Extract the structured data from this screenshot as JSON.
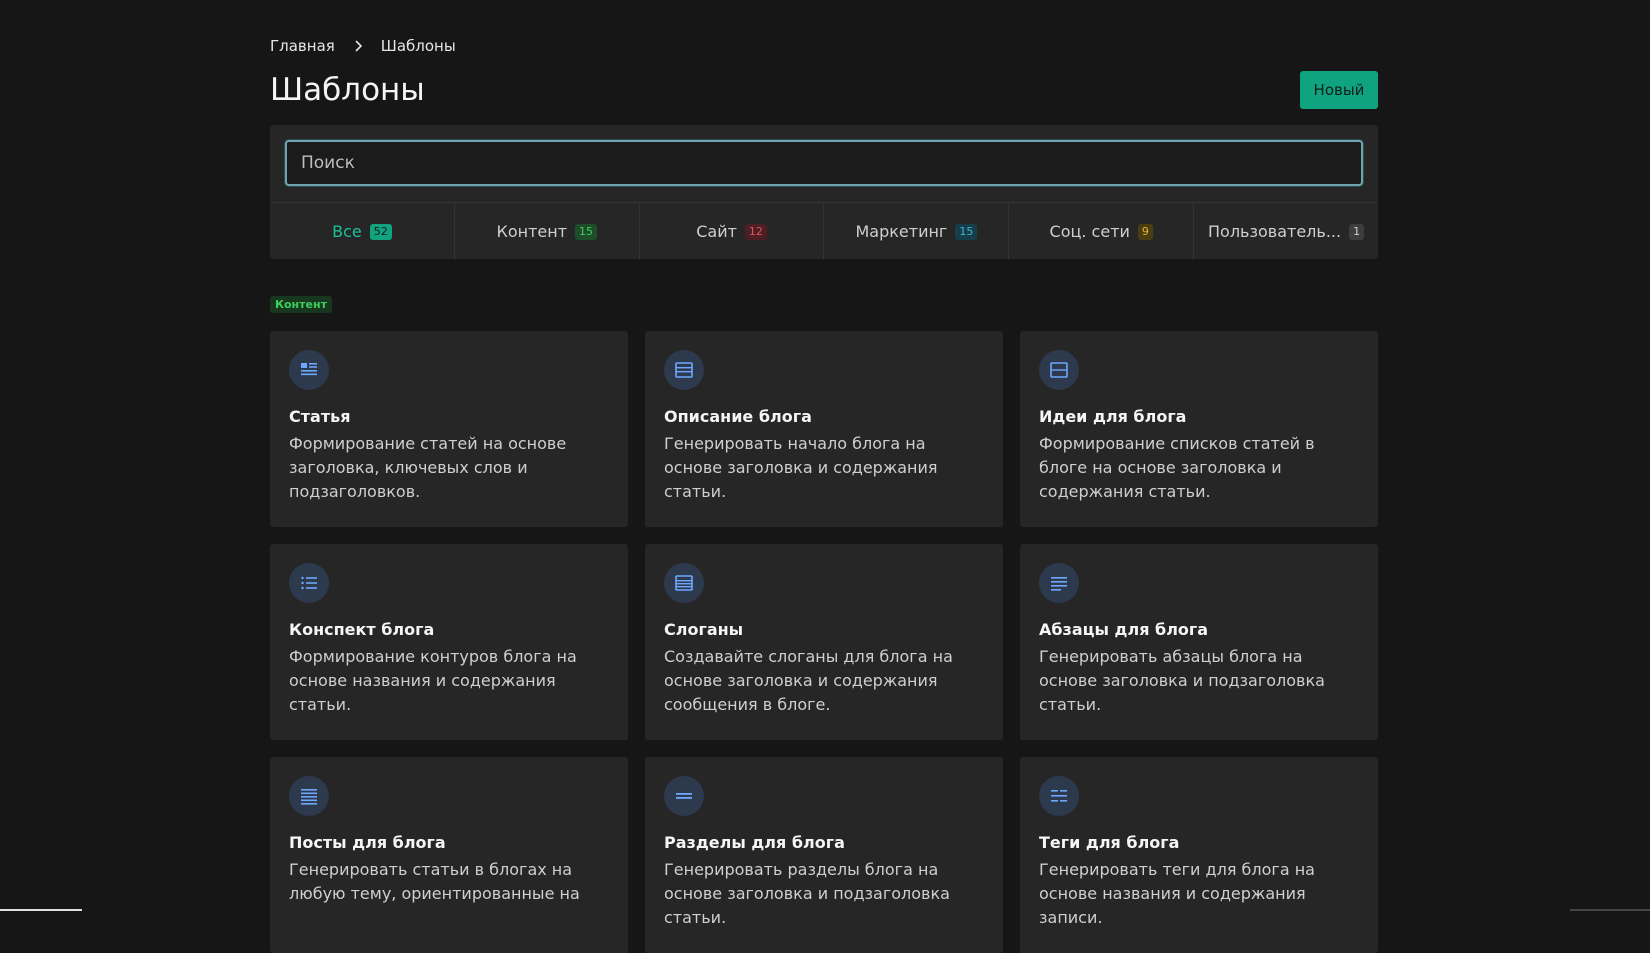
{
  "breadcrumb": {
    "home": "Главная",
    "current": "Шаблоны"
  },
  "header": {
    "title": "Шаблоны",
    "new_button": "Новый"
  },
  "search": {
    "placeholder": "Поиск",
    "value": ""
  },
  "tabs": [
    {
      "label": "Все",
      "count": "52",
      "color": "#10a37f",
      "text_color": "#0f1f1a",
      "active": true
    },
    {
      "label": "Контент",
      "count": "15",
      "color": "#1f4d2a",
      "text_color": "#3ecf5e",
      "active": false
    },
    {
      "label": "Сайт",
      "count": "12",
      "color": "#4d1f24",
      "text_color": "#e0535f",
      "active": false
    },
    {
      "label": "Маркетинг",
      "count": "15",
      "color": "#173c4a",
      "text_color": "#3eb6d6",
      "active": false
    },
    {
      "label": "Соц. сети",
      "count": "9",
      "color": "#4a3d12",
      "text_color": "#e3b537",
      "active": false
    },
    {
      "label": "Пользователь...",
      "count": "1",
      "color": "#3e3e3e",
      "text_color": "#d0d0d0",
      "active": false
    }
  ],
  "section": {
    "tag": "Контент"
  },
  "cards": [
    {
      "icon": "article-icon",
      "title": "Статья",
      "desc": "Формирование статей на основе заголовка, ключевых слов и подзаголовков."
    },
    {
      "icon": "blog-description-icon",
      "title": "Описание блога",
      "desc": "Генерировать начало блога на основе заголовка и содержания статьи."
    },
    {
      "icon": "blog-ideas-icon",
      "title": "Идеи для блога",
      "desc": "Формирование списков статей в блоге на основе заголовка и содержания статьи."
    },
    {
      "icon": "list-icon",
      "title": "Конспект блога",
      "desc": "Формирование контуров блога на основе названия и содержания статьи."
    },
    {
      "icon": "slogans-icon",
      "title": "Слоганы",
      "desc": "Создавайте слоганы для блога на основе заголовка и содержания сообщения в блоге."
    },
    {
      "icon": "paragraph-icon",
      "title": "Абзацы для блога",
      "desc": "Генерировать абзацы блога на основе заголовка и подзаголовка статьи."
    },
    {
      "icon": "blog-posts-icon",
      "title": "Посты для блога",
      "desc": "Генерировать статьи в блогах на любую тему, ориентированные на"
    },
    {
      "icon": "blog-sections-icon",
      "title": "Разделы для блога",
      "desc": "Генерировать разделы блога на основе заголовка и подзаголовка статьи."
    },
    {
      "icon": "blog-tags-icon",
      "title": "Теги для блога",
      "desc": "Генерировать теги для блога на основе названия и содержания записи."
    }
  ]
}
